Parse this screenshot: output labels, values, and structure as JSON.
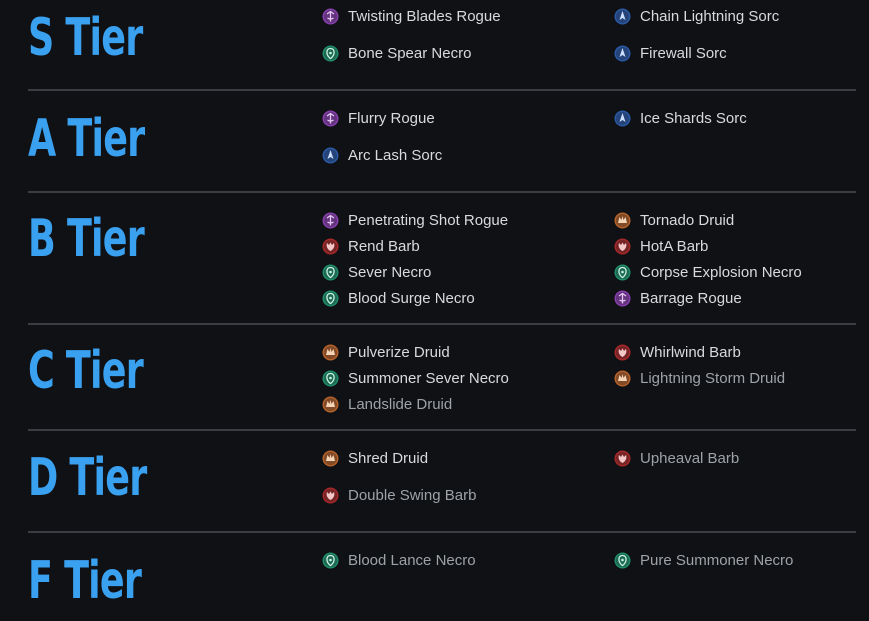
{
  "tiers": [
    {
      "label": "S Tier",
      "builds": [
        {
          "name": "Twisting Blades Rogue",
          "cls": "rogue",
          "icon": "rogue-class-icon",
          "tone": "white"
        },
        {
          "name": "Chain Lightning Sorc",
          "cls": "sorc",
          "icon": "sorcerer-class-icon",
          "tone": "white"
        },
        {
          "name": "Bone Spear Necro",
          "cls": "necro",
          "icon": "necromancer-class-icon",
          "tone": "white"
        },
        {
          "name": "Firewall Sorc",
          "cls": "sorc",
          "icon": "sorcerer-class-icon",
          "tone": "white"
        }
      ]
    },
    {
      "label": "A Tier",
      "builds": [
        {
          "name": "Flurry Rogue",
          "cls": "rogue",
          "icon": "rogue-class-icon",
          "tone": "white"
        },
        {
          "name": "Ice Shards Sorc",
          "cls": "sorc",
          "icon": "sorcerer-class-icon",
          "tone": "white"
        },
        {
          "name": "Arc Lash Sorc",
          "cls": "sorc",
          "icon": "sorcerer-class-icon",
          "tone": "white"
        }
      ]
    },
    {
      "label": "B Tier",
      "builds": [
        {
          "name": "Penetrating Shot Rogue",
          "cls": "rogue",
          "icon": "rogue-class-icon",
          "tone": "white"
        },
        {
          "name": "Tornado Druid",
          "cls": "druid",
          "icon": "druid-class-icon",
          "tone": "white"
        },
        {
          "name": "Rend Barb",
          "cls": "barb",
          "icon": "barbarian-class-icon",
          "tone": "white"
        },
        {
          "name": "HotA Barb",
          "cls": "barb",
          "icon": "barbarian-class-icon",
          "tone": "white"
        },
        {
          "name": "Sever Necro",
          "cls": "necro",
          "icon": "necromancer-class-icon",
          "tone": "white"
        },
        {
          "name": "Corpse Explosion Necro",
          "cls": "necro",
          "icon": "necromancer-class-icon",
          "tone": "white"
        },
        {
          "name": "Blood Surge Necro",
          "cls": "necro",
          "icon": "necromancer-class-icon",
          "tone": "white"
        },
        {
          "name": "Barrage Rogue",
          "cls": "rogue",
          "icon": "rogue-class-icon",
          "tone": "white"
        }
      ]
    },
    {
      "label": "C Tier",
      "builds": [
        {
          "name": "Pulverize Druid",
          "cls": "druid",
          "icon": "druid-class-icon",
          "tone": "white"
        },
        {
          "name": "Whirlwind Barb",
          "cls": "barb",
          "icon": "barbarian-class-icon",
          "tone": "white"
        },
        {
          "name": "Summoner Sever Necro",
          "cls": "necro",
          "icon": "necromancer-class-icon",
          "tone": "white"
        },
        {
          "name": "Lightning Storm Druid",
          "cls": "druid",
          "icon": "druid-class-icon",
          "tone": "gray"
        },
        {
          "name": "Landslide Druid",
          "cls": "druid",
          "icon": "druid-class-icon",
          "tone": "gray"
        }
      ]
    },
    {
      "label": "D Tier",
      "builds": [
        {
          "name": "Shred Druid",
          "cls": "druid",
          "icon": "druid-class-icon",
          "tone": "white"
        },
        {
          "name": "Upheaval Barb",
          "cls": "barb",
          "icon": "barbarian-class-icon",
          "tone": "gray"
        },
        {
          "name": "Double Swing Barb",
          "cls": "barb",
          "icon": "barbarian-class-icon",
          "tone": "gray"
        }
      ]
    },
    {
      "label": "F Tier",
      "builds": [
        {
          "name": "Blood Lance Necro",
          "cls": "necro",
          "icon": "necromancer-class-icon",
          "tone": "gray"
        },
        {
          "name": "Pure Summoner Necro",
          "cls": "necro",
          "icon": "necromancer-class-icon",
          "tone": "gray"
        }
      ]
    }
  ],
  "colors": {
    "tier_title": "#3aa0f0",
    "rogue": "#8a3fb0",
    "sorc": "#2a5aa8",
    "necro": "#1f8f6a",
    "druid": "#b8632a",
    "barb": "#a8282a"
  }
}
